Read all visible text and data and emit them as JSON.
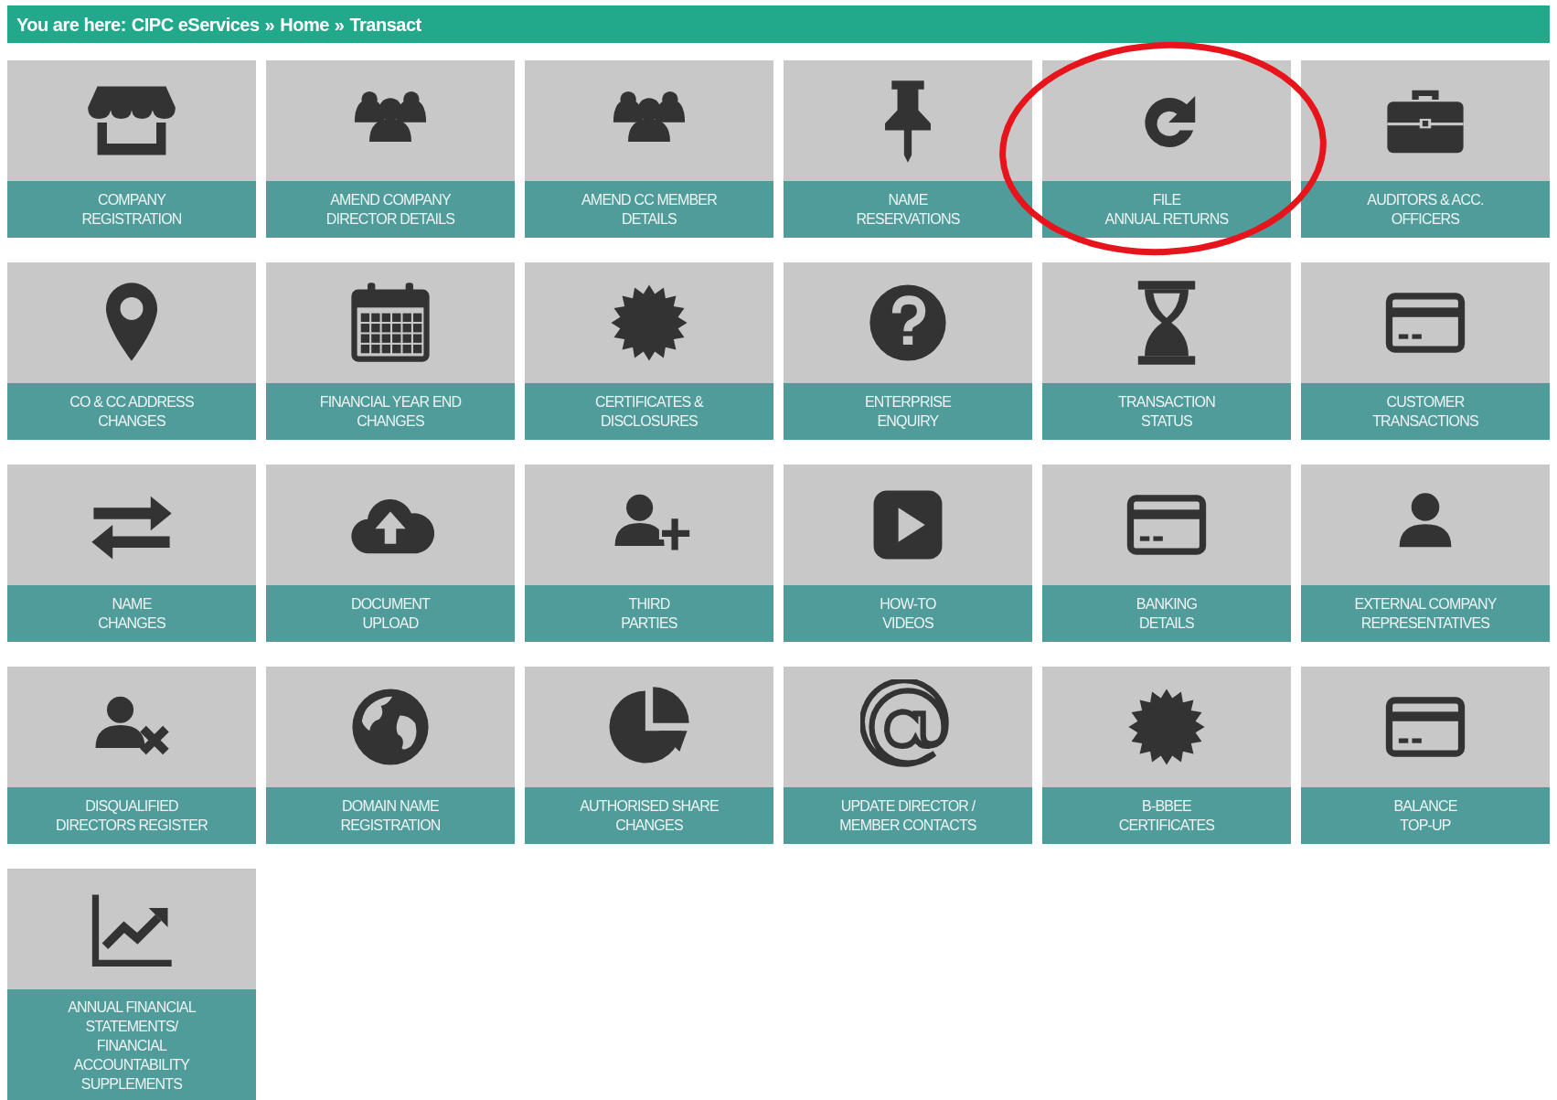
{
  "breadcrumb": {
    "prefix": "You are here:",
    "items": [
      {
        "label": "CIPC eServices"
      },
      {
        "label": "Home"
      },
      {
        "label": "Transact"
      }
    ],
    "separators": [
      "»",
      "»"
    ]
  },
  "tiles": [
    {
      "lines": [
        "COMPANY",
        "REGISTRATION"
      ],
      "circled": false
    },
    {
      "lines": [
        "AMEND COMPANY",
        "DIRECTOR DETAILS"
      ],
      "circled": false
    },
    {
      "lines": [
        "AMEND CC MEMBER",
        "DETAILS"
      ],
      "circled": false
    },
    {
      "lines": [
        "NAME",
        "RESERVATIONS"
      ],
      "circled": false
    },
    {
      "lines": [
        "FILE",
        "ANNUAL RETURNS"
      ],
      "circled": true
    },
    {
      "lines": [
        "AUDITORS & ACC.",
        "OFFICERS"
      ],
      "circled": false
    },
    {
      "lines": [
        "CO & CC ADDRESS",
        "CHANGES"
      ],
      "circled": false
    },
    {
      "lines": [
        "FINANCIAL YEAR END",
        "CHANGES"
      ],
      "circled": false
    },
    {
      "lines": [
        "CERTIFICATES &",
        "DISCLOSURES"
      ],
      "circled": false
    },
    {
      "lines": [
        "ENTERPRISE",
        "ENQUIRY"
      ],
      "circled": false
    },
    {
      "lines": [
        "TRANSACTION",
        "STATUS"
      ],
      "circled": false
    },
    {
      "lines": [
        "CUSTOMER",
        "TRANSACTIONS"
      ],
      "circled": false
    },
    {
      "lines": [
        "NAME",
        "CHANGES"
      ],
      "circled": false
    },
    {
      "lines": [
        "DOCUMENT",
        "UPLOAD"
      ],
      "circled": false
    },
    {
      "lines": [
        "THIRD",
        "PARTIES"
      ],
      "circled": false
    },
    {
      "lines": [
        "HOW-TO",
        "VIDEOS"
      ],
      "circled": false
    },
    {
      "lines": [
        "BANKING",
        "DETAILS"
      ],
      "circled": false
    },
    {
      "lines": [
        "EXTERNAL COMPANY",
        "REPRESENTATIVES"
      ],
      "circled": false
    },
    {
      "lines": [
        "DISQUALIFIED",
        "DIRECTORS REGISTER"
      ],
      "circled": false
    },
    {
      "lines": [
        "DOMAIN NAME",
        "REGISTRATION"
      ],
      "circled": false
    },
    {
      "lines": [
        "AUTHORISED SHARE",
        "CHANGES"
      ],
      "circled": false
    },
    {
      "lines": [
        "UPDATE DIRECTOR /",
        "MEMBER CONTACTS"
      ],
      "circled": false
    },
    {
      "lines": [
        "B-BBEE",
        "CERTIFICATES"
      ],
      "circled": false
    },
    {
      "lines": [
        "BALANCE",
        "TOP-UP"
      ],
      "circled": false
    },
    {
      "lines": [
        "ANNUAL FINANCIAL",
        "STATEMENTS/",
        "FINANCIAL",
        "ACCOUNTABILITY",
        "SUPPLEMENTS"
      ],
      "circled": false
    }
  ]
}
